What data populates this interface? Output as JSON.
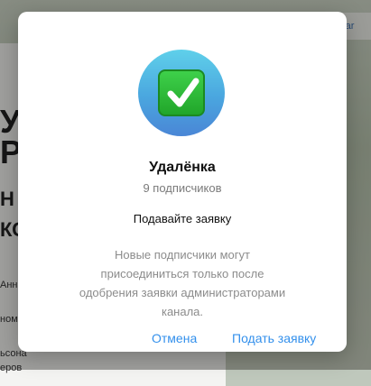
{
  "background": {
    "url_fragment": "/star",
    "big_text_1": "У",
    "big_text_2": "Р",
    "big_text_3": "Н",
    "big_text_4": "КС",
    "small_text_1": "Анна",
    "small_text_2": "ном",
    "small_text_3": "ьсона",
    "small_text_4": "еров"
  },
  "dialog": {
    "channel_name": "Удалёнка",
    "subscribers": "9 подписчиков",
    "request_title": "Подавайте заявку",
    "description": "Новые подписчики могут присоединиться только после одобрения заявки администраторами канала.",
    "cancel_label": "Отмена",
    "apply_label": "Подать заявку"
  },
  "colors": {
    "accent": "#3390ec",
    "muted_text": "#8c8c8c"
  },
  "icons": {
    "avatar_icon": "check-mark-button-emoji"
  }
}
